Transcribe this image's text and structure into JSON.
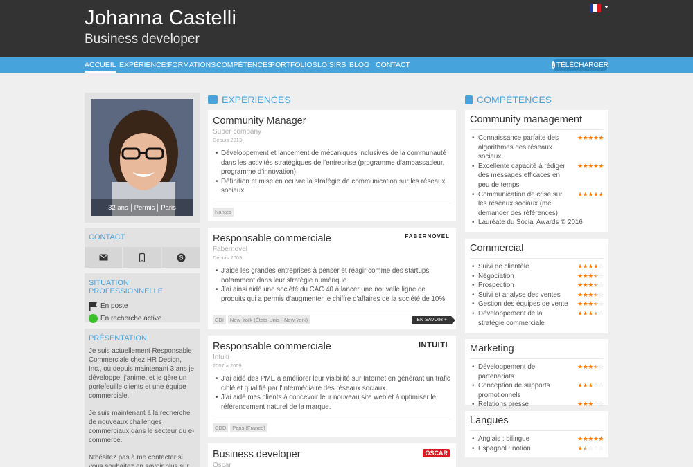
{
  "header": {
    "name": "Johanna Castelli",
    "role": "Business developer",
    "flag_colors": [
      "#1a3aa3",
      "#ffffff",
      "#d71a21"
    ]
  },
  "nav": {
    "items": [
      "ACCUEIL",
      "EXPÉRIENCES",
      "FORMATIONS",
      "COMPÉTENCES",
      "PORTFOLIOS",
      "LOISIRS",
      "BLOG",
      "CONTACT"
    ],
    "download": "TÉLÉCHARGER"
  },
  "profile": {
    "age": "32 ans",
    "license": "Permis",
    "city": "Paris"
  },
  "contact": {
    "title": "CONTACT",
    "icons": [
      "envelope-icon",
      "mobile-icon",
      "skype-icon"
    ]
  },
  "situation": {
    "title": "SITUATION PROFESSIONNELLE",
    "items": [
      "En poste",
      "En recherche active"
    ]
  },
  "presentation": {
    "title": "PRÉSENTATION",
    "paragraphs": [
      "Je suis actuellement Responsable Commerciale chez HR Design, Inc., où depuis maintenant 3 ans je développe, j'anime, et je gère un portefeuille clients et une équipe commerciale.",
      "Je suis maintenant à la recherche de nouveaux challenges commerciaux dans le secteur du e-commerce.",
      "N'hésitez pas à me contacter si vous souhaitez en savoir plus sur mes compétences et mes aspirations"
    ]
  },
  "experiences": {
    "title": "EXPÉRIENCES",
    "items": [
      {
        "title": "Community Manager",
        "company": "Super company",
        "date": "Depuis 2013",
        "bullets": [
          "Développement et lancement de mécaniques inclusives de la communauté dans les activités stratégiques de l'entreprise (programme d'ambassadeur, programme d'innovation)",
          "Définition et mise en oeuvre la stratégie de communication sur les réseaux sociaux"
        ],
        "tags": [
          "Nantes"
        ]
      },
      {
        "title": "Responsable commerciale",
        "company": "Fabernovel",
        "date": "Depuis 2009",
        "logo": "FABERNOVEL",
        "bullets": [
          "J'aide les grandes entreprises à penser et réagir comme des startups notamment dans leur stratégie numérique",
          "J'ai ainsi aidé une société du CAC 40 à lancer une nouvelle ligne de produits qui a permis d'augmenter le chiffre d'affaires de la société de 10%"
        ],
        "tags": [
          "CDI",
          "New-York (États-Unis - New York)"
        ],
        "more": "EN SAVOIR +"
      },
      {
        "title": "Responsable commerciale",
        "company": "Intuiti",
        "date": "2007 à 2009",
        "logo": "INTUITI",
        "bullets": [
          "J'ai aidé des PME à améliorer leur visibilité sur Internet en générant un trafic ciblé et qualifié par l'intermédiaire des réseaux sociaux.",
          "J'ai aidé mes clients à concevoir leur nouveau site web et à optimiser le référencement naturel de la marque."
        ],
        "tags": [
          "CDD",
          "Paris (France)"
        ]
      },
      {
        "title": "Business developer",
        "company": "Oscar",
        "logo": "OSCAR"
      }
    ]
  },
  "skills": {
    "title": "COMPÉTENCES",
    "groups": [
      {
        "title": "Community management",
        "items": [
          {
            "name": "Connaissance parfaite des algorithmes des réseaux sociaux",
            "rating": 5
          },
          {
            "name": "Excellente capacité à rédiger des messages efficaces en peu de temps",
            "rating": 5
          },
          {
            "name": "Communication de crise sur les réseaux sociaux (me demander des références)",
            "rating": 5
          },
          {
            "name": "Lauréate du Social Awards © 2016",
            "rating": 0
          }
        ]
      },
      {
        "title": "Commercial",
        "items": [
          {
            "name": "Suivi de clientèle",
            "rating": 4
          },
          {
            "name": "Négociation",
            "rating": 3.5
          },
          {
            "name": "Prospection",
            "rating": 3.5
          },
          {
            "name": "Suivi et analyse des ventes",
            "rating": 3.5
          },
          {
            "name": "Gestion des équipes de vente",
            "rating": 3.5
          },
          {
            "name": "Développement de la stratégie commerciale",
            "rating": 3.5
          }
        ]
      },
      {
        "title": "Marketing",
        "items": [
          {
            "name": "Développement de partenariats",
            "rating": 3.5
          },
          {
            "name": "Conception de supports promotionnels",
            "rating": 3
          },
          {
            "name": "Relations presse",
            "rating": 3
          }
        ]
      },
      {
        "title": "Langues",
        "items": [
          {
            "name": "Anglais : bilingue",
            "rating": 5
          },
          {
            "name": "Espagnol : notion",
            "rating": 1.5
          }
        ]
      }
    ]
  }
}
